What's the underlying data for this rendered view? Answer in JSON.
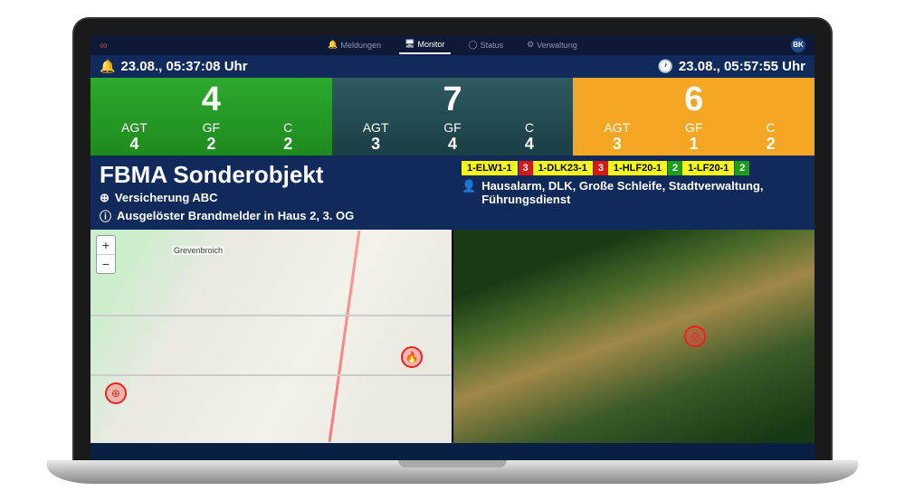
{
  "nav": {
    "items": [
      {
        "icon": "🔔",
        "label": "Meldungen"
      },
      {
        "icon": "🖥",
        "label": "Monitor"
      },
      {
        "icon": "◯",
        "label": "Status"
      },
      {
        "icon": "⚙",
        "label": "Verwaltung"
      }
    ],
    "user_initials": "BK"
  },
  "times": {
    "left": "23.08., 05:37:08 Uhr",
    "right": "23.08., 05:57:55 Uhr"
  },
  "cards": [
    {
      "color": "green",
      "big": "4",
      "cols": [
        {
          "lbl": "AGT",
          "val": "4"
        },
        {
          "lbl": "GF",
          "val": "2"
        },
        {
          "lbl": "C",
          "val": "2"
        }
      ]
    },
    {
      "color": "steel",
      "big": "7",
      "cols": [
        {
          "lbl": "AGT",
          "val": "3"
        },
        {
          "lbl": "GF",
          "val": "4"
        },
        {
          "lbl": "C",
          "val": "4"
        }
      ]
    },
    {
      "color": "orange",
      "big": "6",
      "cols": [
        {
          "lbl": "AGT",
          "val": "3"
        },
        {
          "lbl": "GF",
          "val": "1"
        },
        {
          "lbl": "C",
          "val": "2"
        }
      ]
    }
  ],
  "incident": {
    "title": "FBMA Sonderobjekt",
    "location": "Versicherung ABC",
    "detail": "Ausgelöster Brandmelder in Haus 2, 3. OG"
  },
  "vehicles": [
    {
      "name": "1-ELW1-1",
      "num": "3",
      "numcolor": "red"
    },
    {
      "name": "1-DLK23-1",
      "num": "3",
      "numcolor": "red"
    },
    {
      "name": "1-HLF20-1",
      "num": "2",
      "numcolor": "green"
    },
    {
      "name": "1-LF20-1",
      "num": "2",
      "numcolor": "green"
    }
  ],
  "units_text": "Hausalarm, DLK, Große Schleife, Stadtverwaltung, Führungsdienst",
  "map": {
    "zoom_in": "+",
    "zoom_out": "−",
    "place": "Grevenbroich"
  }
}
